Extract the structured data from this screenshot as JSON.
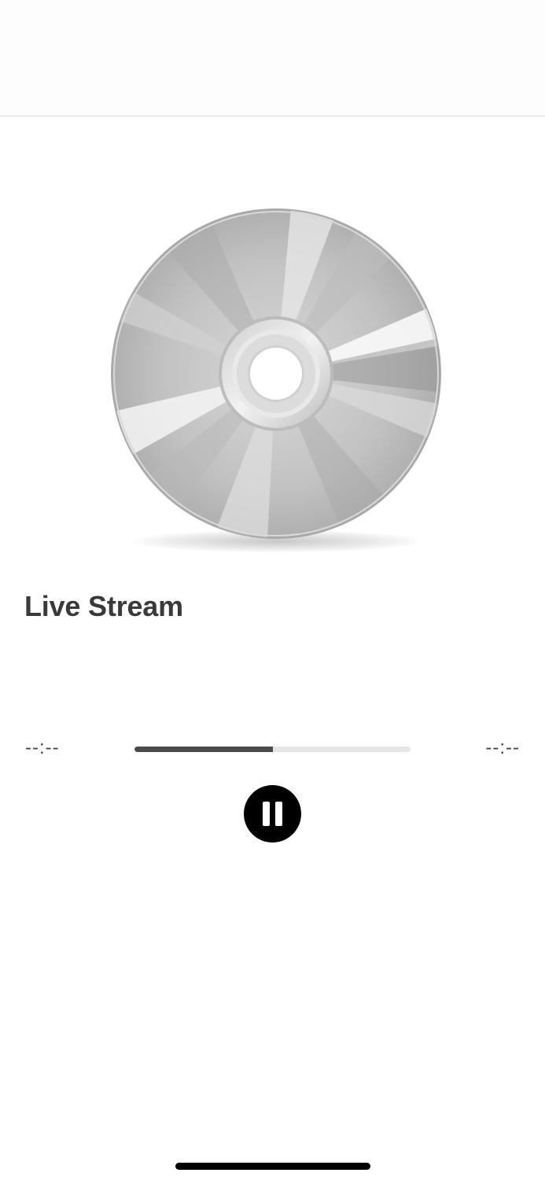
{
  "player": {
    "track_title": "Live Stream",
    "elapsed_time": "--:--",
    "remaining_time": "--:--",
    "progress": 0.5,
    "playback_state": "playing",
    "control_icon": "pause-icon"
  },
  "artwork": {
    "icon": "compact-disc-icon"
  },
  "colors": {
    "background": "#ffffff",
    "progress_fill": "#4a4a4a",
    "progress_track": "#e6e6e6",
    "control_button": "#000000"
  }
}
